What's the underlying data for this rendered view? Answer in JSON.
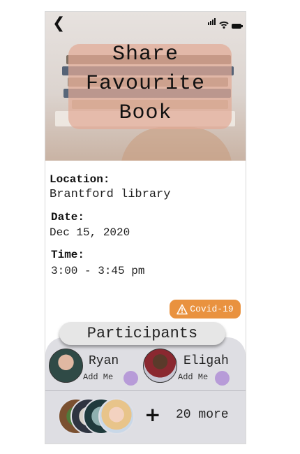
{
  "screen": {
    "title_lines": [
      "Share",
      "Favourite",
      "Book"
    ]
  },
  "details": {
    "location_label": "Location:",
    "location_value": "Brantford library",
    "date_label": "Date:",
    "date_value": "Dec 15, 2020",
    "time_label": "Time:",
    "time_value": "3:00 - 3:45 pm"
  },
  "covid_badge": {
    "label": "Covid-19",
    "icon": "warning-icon",
    "color": "#e9923f"
  },
  "participants": {
    "heading": "Participants",
    "people": [
      {
        "name": "Ryan",
        "action": "Add Me"
      },
      {
        "name": "Eligah",
        "action": "Add Me"
      }
    ],
    "more_label": "20 more",
    "add_icon": "plus-icon"
  },
  "colors": {
    "accent_purple": "#b79bd8",
    "panel": "#dedee3",
    "title_card": "#e2aa96"
  }
}
